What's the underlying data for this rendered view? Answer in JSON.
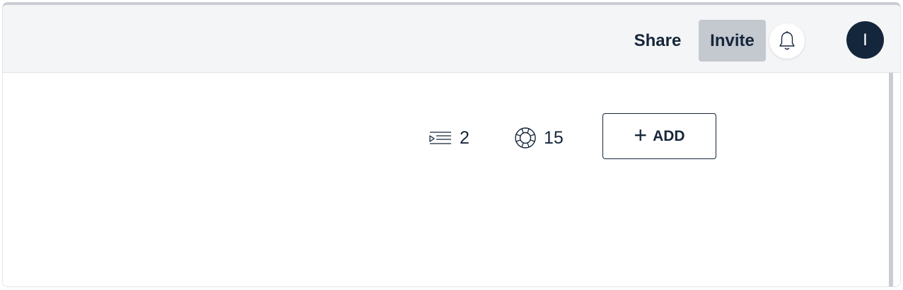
{
  "header": {
    "share_label": "Share",
    "invite_label": "Invite",
    "bell_icon": "bell-icon",
    "avatar_initial": "I"
  },
  "stats": {
    "tasks": {
      "icon": "list-indent-icon",
      "count": "2"
    },
    "help": {
      "icon": "lifebuoy-icon",
      "count": "15"
    }
  },
  "actions": {
    "add_plus": "+",
    "add_label": "ADD"
  },
  "colors": {
    "primary_text": "#16263a",
    "invite_bg": "#c4c8cf",
    "avatar_bg": "#14263b",
    "topbar_bg": "#f4f5f7"
  }
}
